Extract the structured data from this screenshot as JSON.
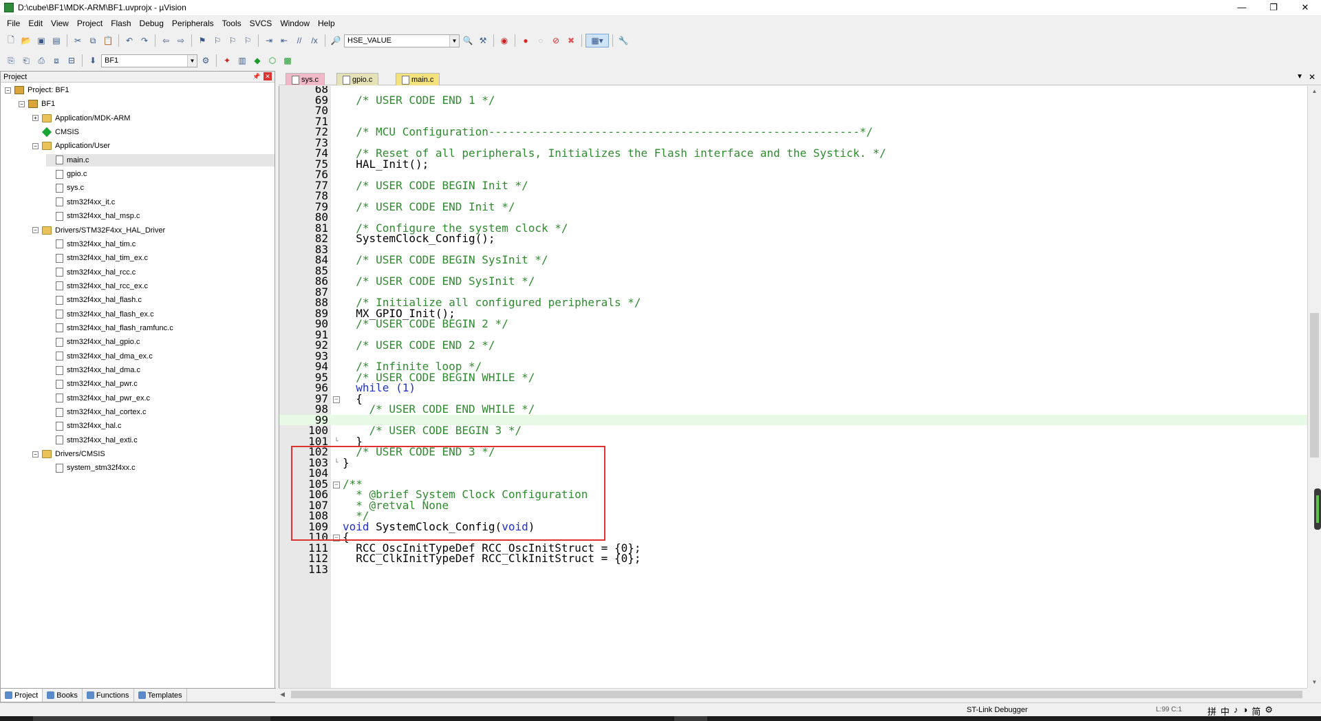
{
  "window": {
    "title": "D:\\cube\\BF1\\MDK-ARM\\BF1.uvprojx - µVision",
    "minimize": "—",
    "maximize": "❐",
    "close": "✕"
  },
  "menu": [
    "File",
    "Edit",
    "View",
    "Project",
    "Flash",
    "Debug",
    "Peripherals",
    "Tools",
    "SVCS",
    "Window",
    "Help"
  ],
  "toolbar": {
    "find_combo_value": "HSE_VALUE",
    "target_combo_value": "BF1"
  },
  "project_panel": {
    "title": "Project",
    "tree": [
      {
        "label": "Project: BF1",
        "level": 0,
        "icon": "project",
        "expander": "−"
      },
      {
        "label": "BF1",
        "level": 1,
        "icon": "target",
        "expander": "−"
      },
      {
        "label": "Application/MDK-ARM",
        "level": 2,
        "icon": "folder",
        "expander": "+"
      },
      {
        "label": "CMSIS",
        "level": 2,
        "icon": "diamond",
        "expander": ""
      },
      {
        "label": "Application/User",
        "level": 2,
        "icon": "folder",
        "expander": "−"
      },
      {
        "label": "main.c",
        "level": 3,
        "icon": "file",
        "expander": "",
        "selected": true
      },
      {
        "label": "gpio.c",
        "level": 3,
        "icon": "file",
        "expander": ""
      },
      {
        "label": "sys.c",
        "level": 3,
        "icon": "file",
        "expander": ""
      },
      {
        "label": "stm32f4xx_it.c",
        "level": 3,
        "icon": "file",
        "expander": ""
      },
      {
        "label": "stm32f4xx_hal_msp.c",
        "level": 3,
        "icon": "file",
        "expander": ""
      },
      {
        "label": "Drivers/STM32F4xx_HAL_Driver",
        "level": 2,
        "icon": "folder",
        "expander": "−"
      },
      {
        "label": "stm32f4xx_hal_tim.c",
        "level": 3,
        "icon": "file",
        "expander": ""
      },
      {
        "label": "stm32f4xx_hal_tim_ex.c",
        "level": 3,
        "icon": "file",
        "expander": ""
      },
      {
        "label": "stm32f4xx_hal_rcc.c",
        "level": 3,
        "icon": "file",
        "expander": ""
      },
      {
        "label": "stm32f4xx_hal_rcc_ex.c",
        "level": 3,
        "icon": "file",
        "expander": ""
      },
      {
        "label": "stm32f4xx_hal_flash.c",
        "level": 3,
        "icon": "file",
        "expander": ""
      },
      {
        "label": "stm32f4xx_hal_flash_ex.c",
        "level": 3,
        "icon": "file",
        "expander": ""
      },
      {
        "label": "stm32f4xx_hal_flash_ramfunc.c",
        "level": 3,
        "icon": "file",
        "expander": ""
      },
      {
        "label": "stm32f4xx_hal_gpio.c",
        "level": 3,
        "icon": "file",
        "expander": ""
      },
      {
        "label": "stm32f4xx_hal_dma_ex.c",
        "level": 3,
        "icon": "file",
        "expander": ""
      },
      {
        "label": "stm32f4xx_hal_dma.c",
        "level": 3,
        "icon": "file",
        "expander": ""
      },
      {
        "label": "stm32f4xx_hal_pwr.c",
        "level": 3,
        "icon": "file",
        "expander": ""
      },
      {
        "label": "stm32f4xx_hal_pwr_ex.c",
        "level": 3,
        "icon": "file",
        "expander": ""
      },
      {
        "label": "stm32f4xx_hal_cortex.c",
        "level": 3,
        "icon": "file",
        "expander": ""
      },
      {
        "label": "stm32f4xx_hal.c",
        "level": 3,
        "icon": "file",
        "expander": ""
      },
      {
        "label": "stm32f4xx_hal_exti.c",
        "level": 3,
        "icon": "file",
        "expander": ""
      },
      {
        "label": "Drivers/CMSIS",
        "level": 2,
        "icon": "folder",
        "expander": "−"
      },
      {
        "label": "system_stm32f4xx.c",
        "level": 3,
        "icon": "file",
        "expander": ""
      }
    ],
    "tabs": [
      {
        "label": "Project",
        "active": true
      },
      {
        "label": "Books",
        "active": false
      },
      {
        "label": "Functions",
        "active": false
      },
      {
        "label": "Templates",
        "active": false
      }
    ]
  },
  "editor": {
    "tabs": [
      {
        "label": "sys.c",
        "cls": "sys"
      },
      {
        "label": "gpio.c",
        "cls": "gpio"
      },
      {
        "label": "main.c",
        "cls": "main",
        "active": true
      }
    ],
    "current_line": 99,
    "lines": [
      {
        "n": "68",
        "t": "",
        "k": "plain"
      },
      {
        "n": "69",
        "t": "  /* USER CODE END 1 */",
        "k": "cmt"
      },
      {
        "n": "70",
        "t": "",
        "k": "plain"
      },
      {
        "n": "71",
        "t": "",
        "k": "plain"
      },
      {
        "n": "72",
        "t": "  /* MCU Configuration--------------------------------------------------------*/",
        "k": "cmt"
      },
      {
        "n": "73",
        "t": "",
        "k": "plain"
      },
      {
        "n": "74",
        "t": "  /* Reset of all peripherals, Initializes the Flash interface and the Systick. */",
        "k": "cmt"
      },
      {
        "n": "75",
        "t": "  HAL_Init();",
        "k": "plain"
      },
      {
        "n": "76",
        "t": "",
        "k": "plain"
      },
      {
        "n": "77",
        "t": "  /* USER CODE BEGIN Init */",
        "k": "cmt"
      },
      {
        "n": "78",
        "t": "",
        "k": "plain"
      },
      {
        "n": "79",
        "t": "  /* USER CODE END Init */",
        "k": "cmt"
      },
      {
        "n": "80",
        "t": "",
        "k": "plain"
      },
      {
        "n": "81",
        "t": "  /* Configure the system clock */",
        "k": "cmt"
      },
      {
        "n": "82",
        "t": "  SystemClock_Config();",
        "k": "plain"
      },
      {
        "n": "83",
        "t": "",
        "k": "plain"
      },
      {
        "n": "84",
        "t": "  /* USER CODE BEGIN SysInit */",
        "k": "cmt"
      },
      {
        "n": "85",
        "t": "",
        "k": "plain"
      },
      {
        "n": "86",
        "t": "  /* USER CODE END SysInit */",
        "k": "cmt"
      },
      {
        "n": "87",
        "t": "",
        "k": "plain"
      },
      {
        "n": "88",
        "t": "  /* Initialize all configured peripherals */",
        "k": "cmt"
      },
      {
        "n": "89",
        "t": "  MX_GPIO_Init();",
        "k": "plain"
      },
      {
        "n": "90",
        "t": "  /* USER CODE BEGIN 2 */",
        "k": "cmt"
      },
      {
        "n": "91",
        "t": "",
        "k": "plain"
      },
      {
        "n": "92",
        "t": "  /* USER CODE END 2 */",
        "k": "cmt"
      },
      {
        "n": "93",
        "t": "",
        "k": "plain"
      },
      {
        "n": "94",
        "t": "  /* Infinite loop */",
        "k": "cmt"
      },
      {
        "n": "95",
        "t": "  /* USER CODE BEGIN WHILE */",
        "k": "cmt"
      },
      {
        "n": "96",
        "t": "  while (1)",
        "k": "kw"
      },
      {
        "n": "97",
        "t": "  {",
        "k": "plain",
        "fold": "box"
      },
      {
        "n": "98",
        "t": "    /* USER CODE END WHILE */",
        "k": "cmt"
      },
      {
        "n": "99",
        "t": "",
        "k": "plain"
      },
      {
        "n": "100",
        "t": "    /* USER CODE BEGIN 3 */",
        "k": "cmt"
      },
      {
        "n": "101",
        "t": "  }",
        "k": "plain",
        "fold": "end"
      },
      {
        "n": "102",
        "t": "  /* USER CODE END 3 */",
        "k": "cmt"
      },
      {
        "n": "103",
        "t": "}",
        "k": "plain",
        "fold": "end"
      },
      {
        "n": "104",
        "t": "",
        "k": "plain"
      },
      {
        "n": "105",
        "t": "/**",
        "k": "cmt",
        "fold": "box"
      },
      {
        "n": "106",
        "t": "  * @brief System Clock Configuration",
        "k": "cmt"
      },
      {
        "n": "107",
        "t": "  * @retval None",
        "k": "cmt"
      },
      {
        "n": "108",
        "t": "  */",
        "k": "cmt"
      },
      {
        "n": "109",
        "t": "void SystemClock_Config(void)",
        "k": "fn"
      },
      {
        "n": "110",
        "t": "{",
        "k": "plain",
        "fold": "box"
      },
      {
        "n": "111",
        "t": "  RCC_OscInitTypeDef RCC_OscInitStruct = {0};",
        "k": "plain"
      },
      {
        "n": "112",
        "t": "  RCC_ClkInitTypeDef RCC_ClkInitStruct = {0};",
        "k": "plain"
      },
      {
        "n": "113",
        "t": "",
        "k": "plain"
      }
    ]
  },
  "status": {
    "debugger": "ST-Link Debugger",
    "position": "L:99 C:1",
    "ime": [
      "拼",
      "中",
      "♪",
      "◑",
      "简",
      "⚙"
    ]
  },
  "colors": {
    "comment": "#2e8b2e",
    "keyword": "#1f2fd0",
    "current_line_bg": "#e6fae6",
    "highlight_box": "#e03030"
  }
}
